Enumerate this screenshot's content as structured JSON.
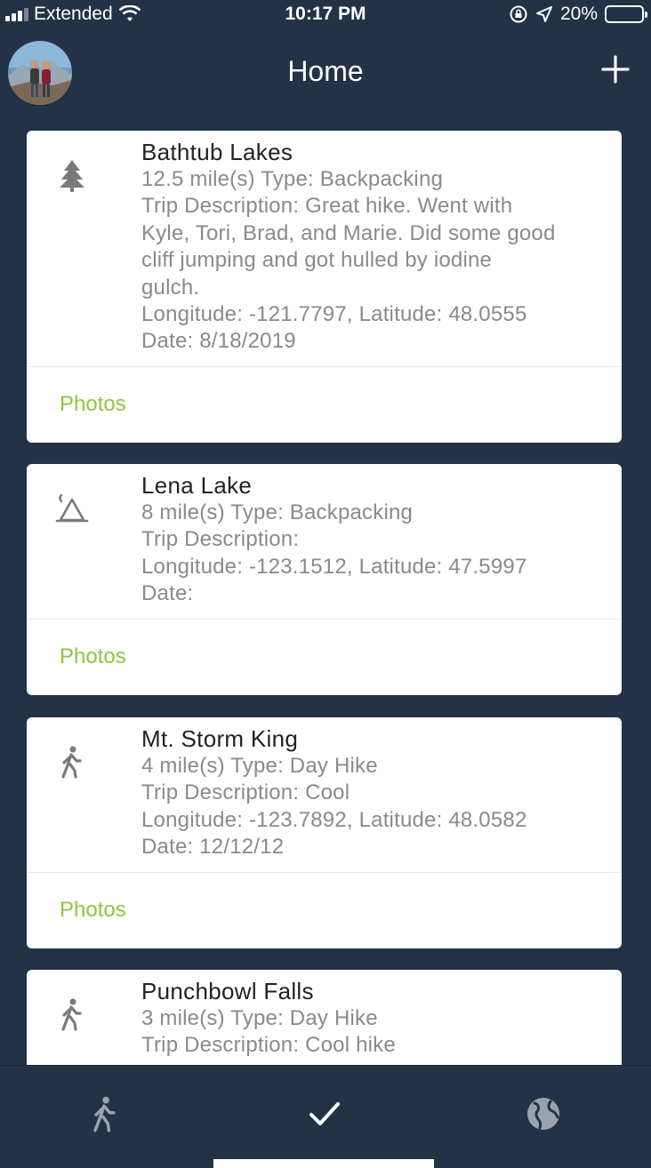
{
  "status_bar": {
    "carrier": "Extended",
    "time": "10:17 PM",
    "battery": "20%",
    "battery_level": 0.2
  },
  "nav": {
    "title": "Home",
    "avatar_icon": "profile-photo",
    "add_icon": "plus-icon"
  },
  "colors": {
    "background": "#243247",
    "card": "#ffffff",
    "accent": "#8cc63f",
    "icon_gray": "#7a7a7a"
  },
  "trips": [
    {
      "name": "Bathtub Lakes",
      "icon": "tree-icon",
      "summary": "12.5 mile(s)  Type: Backpacking",
      "description_lines": [
        "Trip Description: Great hike. Went with",
        "Kyle, Tori, Brad, and Marie. Did some good",
        "cliff jumping and got hulled by iodine",
        "gulch."
      ],
      "coordinates": "Longitude: -121.7797, Latitude: 48.0555",
      "date": "Date: 8/18/2019",
      "photos_label": "Photos"
    },
    {
      "name": "Lena Lake",
      "icon": "tent-icon",
      "summary": "8 mile(s)  Type: Backpacking",
      "description_lines": [
        "Trip Description:"
      ],
      "coordinates": "Longitude: -123.1512, Latitude: 47.5997",
      "date": "Date:",
      "photos_label": "Photos"
    },
    {
      "name": "Mt. Storm King",
      "icon": "hiker-icon",
      "summary": "4 mile(s)  Type: Day Hike",
      "description_lines": [
        "Trip Description: Cool"
      ],
      "coordinates": "Longitude: -123.7892, Latitude: 48.0582",
      "date": "Date: 12/12/12",
      "photos_label": "Photos"
    },
    {
      "name": "Punchbowl Falls",
      "icon": "hiker-icon",
      "summary": "3 mile(s)  Type: Day Hike",
      "description_lines": [
        "Trip Description: Cool hike"
      ]
    }
  ],
  "tabs": [
    {
      "icon": "hiker-icon"
    },
    {
      "icon": "checkmark-icon"
    },
    {
      "icon": "globe-icon"
    }
  ]
}
